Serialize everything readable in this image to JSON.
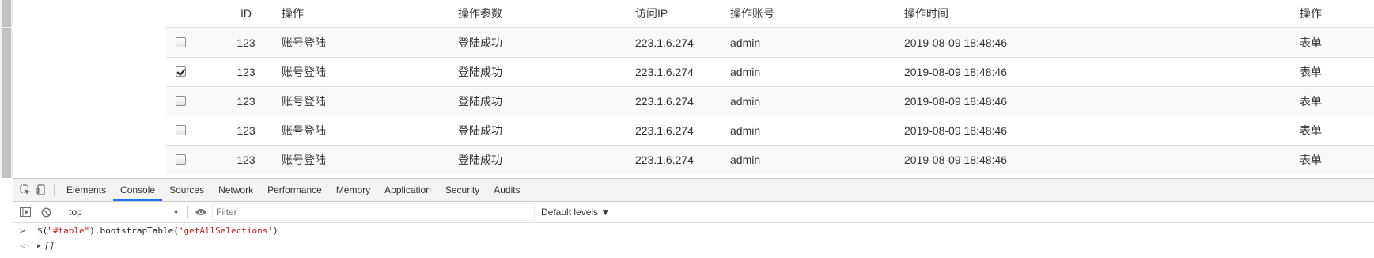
{
  "table": {
    "headers": {
      "id": "ID",
      "operation": "操作",
      "params": "操作参数",
      "ip": "访问IP",
      "account": "操作账号",
      "time": "操作时间",
      "action": "操作"
    },
    "rows": [
      {
        "checked": false,
        "id": "123",
        "operation": "账号登陆",
        "params": "登陆成功",
        "ip": "223.1.6.274",
        "account": "admin",
        "time": "2019-08-09 18:48:46",
        "action": "表单"
      },
      {
        "checked": true,
        "id": "123",
        "operation": "账号登陆",
        "params": "登陆成功",
        "ip": "223.1.6.274",
        "account": "admin",
        "time": "2019-08-09 18:48:46",
        "action": "表单"
      },
      {
        "checked": false,
        "id": "123",
        "operation": "账号登陆",
        "params": "登陆成功",
        "ip": "223.1.6.274",
        "account": "admin",
        "time": "2019-08-09 18:48:46",
        "action": "表单"
      },
      {
        "checked": false,
        "id": "123",
        "operation": "账号登陆",
        "params": "登陆成功",
        "ip": "223.1.6.274",
        "account": "admin",
        "time": "2019-08-09 18:48:46",
        "action": "表单"
      },
      {
        "checked": false,
        "id": "123",
        "operation": "账号登陆",
        "params": "登陆成功",
        "ip": "223.1.6.274",
        "account": "admin",
        "time": "2019-08-09 18:48:46",
        "action": "表单"
      }
    ]
  },
  "devtools": {
    "tabs": [
      "Elements",
      "Console",
      "Sources",
      "Network",
      "Performance",
      "Memory",
      "Application",
      "Security",
      "Audits"
    ],
    "active_tab": "Console",
    "context": "top",
    "filter_placeholder": "Filter",
    "levels": "Default levels ▼",
    "console": {
      "command_prefix": "$(",
      "command_arg1": "\"#table\"",
      "command_mid": ").bootstrapTable(",
      "command_arg2": "'getAllSelections'",
      "command_suffix": ")",
      "result": "[]"
    },
    "accent_color": "#1a73e8"
  }
}
